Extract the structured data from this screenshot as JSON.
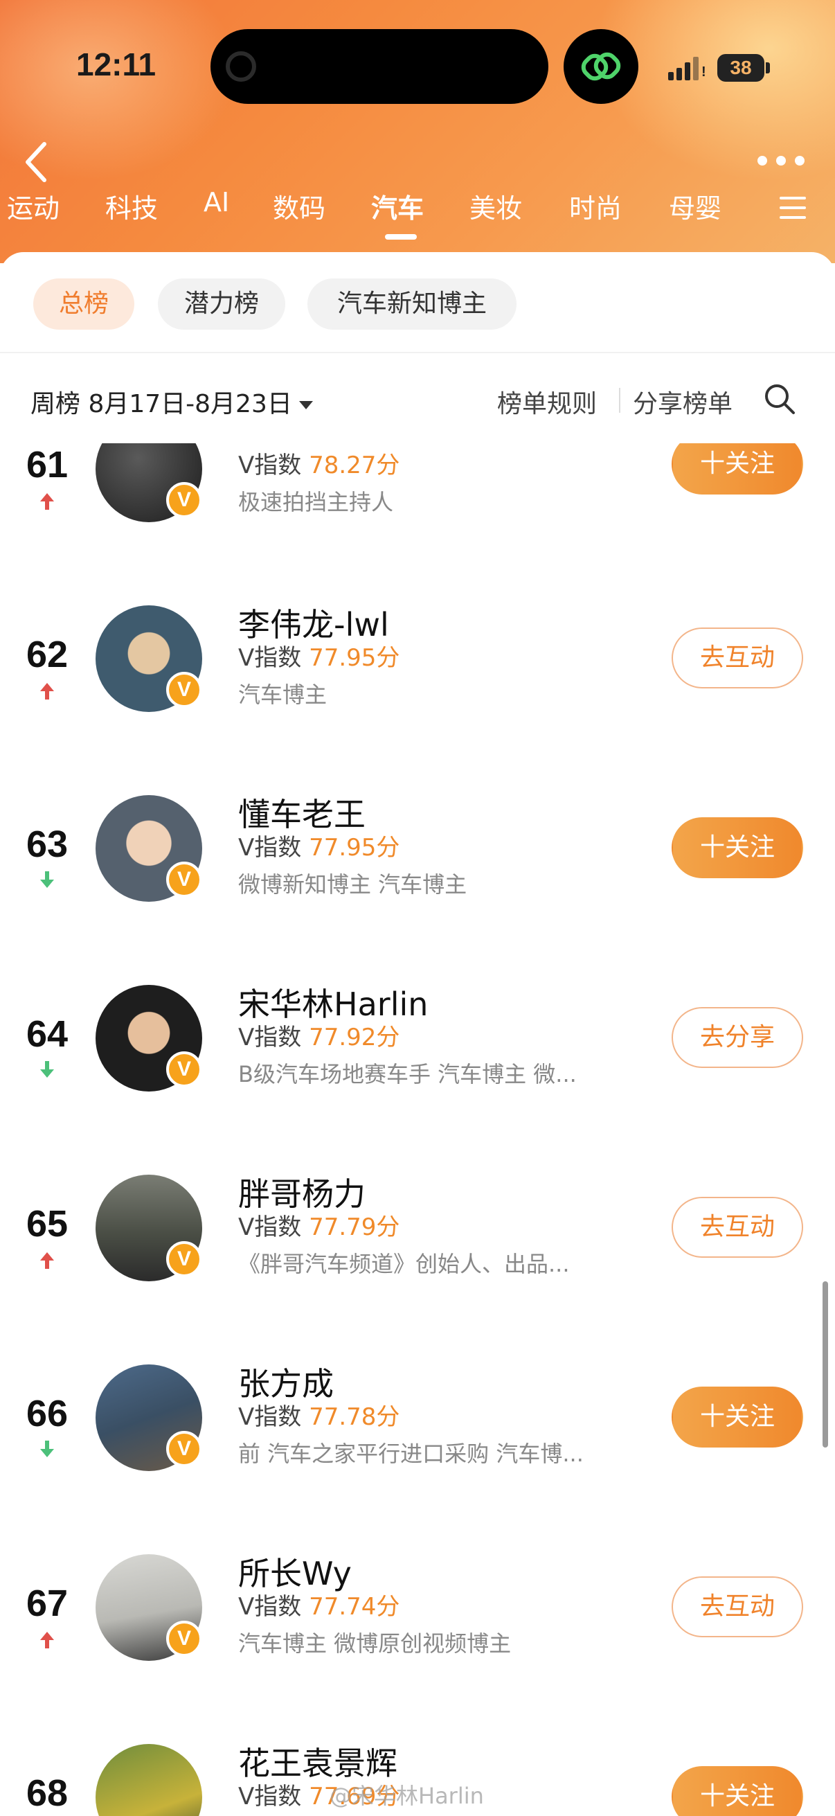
{
  "status_bar": {
    "time": "12:11",
    "battery": "38"
  },
  "categories": [
    {
      "label": "运动",
      "active": false
    },
    {
      "label": "科技",
      "active": false
    },
    {
      "label": "AI",
      "active": false
    },
    {
      "label": "数码",
      "active": false
    },
    {
      "label": "汽车",
      "active": true
    },
    {
      "label": "美妆",
      "active": false
    },
    {
      "label": "时尚",
      "active": false
    },
    {
      "label": "母婴",
      "active": false
    }
  ],
  "chips": [
    {
      "label": "总榜",
      "active": true
    },
    {
      "label": "潜力榜",
      "active": false
    },
    {
      "label": "汽车新知博主",
      "active": false
    }
  ],
  "filter": {
    "week": "周榜 8月17日-8月23日",
    "rules": "榜单规则",
    "share": "分享榜单"
  },
  "score_prefix": "V指数",
  "rows": [
    {
      "rank": "61",
      "trend": "up",
      "name": "",
      "score": "78.27分",
      "desc": "极速拍挡主持人",
      "action": "十关注",
      "action_style": "follow"
    },
    {
      "rank": "62",
      "trend": "up",
      "name": "李伟龙-lwl",
      "score": "77.95分",
      "desc": "汽车博主",
      "action": "去互动",
      "action_style": "outline"
    },
    {
      "rank": "63",
      "trend": "down",
      "name": "懂车老王",
      "score": "77.95分",
      "desc": "微博新知博主 汽车博主",
      "action": "十关注",
      "action_style": "follow"
    },
    {
      "rank": "64",
      "trend": "down",
      "name": "宋华林Harlin",
      "score": "77.92分",
      "desc": "B级汽车场地赛车手 汽车博主 微...",
      "action": "去分享",
      "action_style": "outline"
    },
    {
      "rank": "65",
      "trend": "up",
      "name": "胖哥杨力",
      "score": "77.79分",
      "desc": "《胖哥汽车频道》创始人、出品...",
      "action": "去互动",
      "action_style": "outline"
    },
    {
      "rank": "66",
      "trend": "down",
      "name": "张方成",
      "score": "77.78分",
      "desc": "前 汽车之家平行进口采购 汽车博...",
      "action": "十关注",
      "action_style": "follow"
    },
    {
      "rank": "67",
      "trend": "up",
      "name": "所长Wy",
      "score": "77.74分",
      "desc": "汽车博主 微博原创视频博主",
      "action": "去互动",
      "action_style": "outline"
    },
    {
      "rank": "68",
      "trend": "up",
      "name": "花王袁景辉",
      "score": "77.69分",
      "desc": "",
      "action": "十关注",
      "action_style": "follow"
    }
  ],
  "watermark": "@宋华林Harlin",
  "colors": {
    "accent": "#f0892d",
    "up": "#e0504a",
    "down": "#4cc07a"
  }
}
